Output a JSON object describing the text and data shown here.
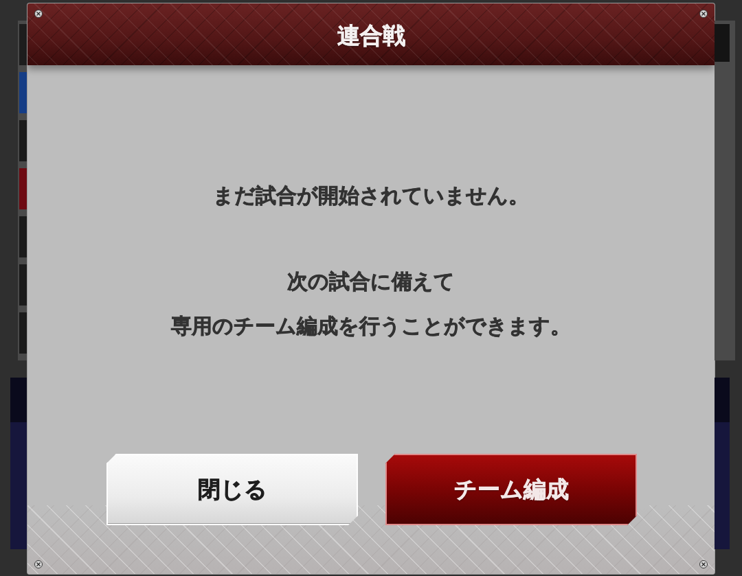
{
  "dialog": {
    "title": "連合戦"
  },
  "message": {
    "paragraphs": [
      {
        "lines": [
          "まだ試合が開始されていません。"
        ]
      },
      {
        "lines": [
          "次の試合に備えて",
          "専用のチーム編成を行うことができます。"
        ]
      }
    ]
  },
  "buttons": [
    {
      "label": "閉じる",
      "kind": "secondary"
    },
    {
      "label": "チーム編成",
      "kind": "primary"
    }
  ]
}
